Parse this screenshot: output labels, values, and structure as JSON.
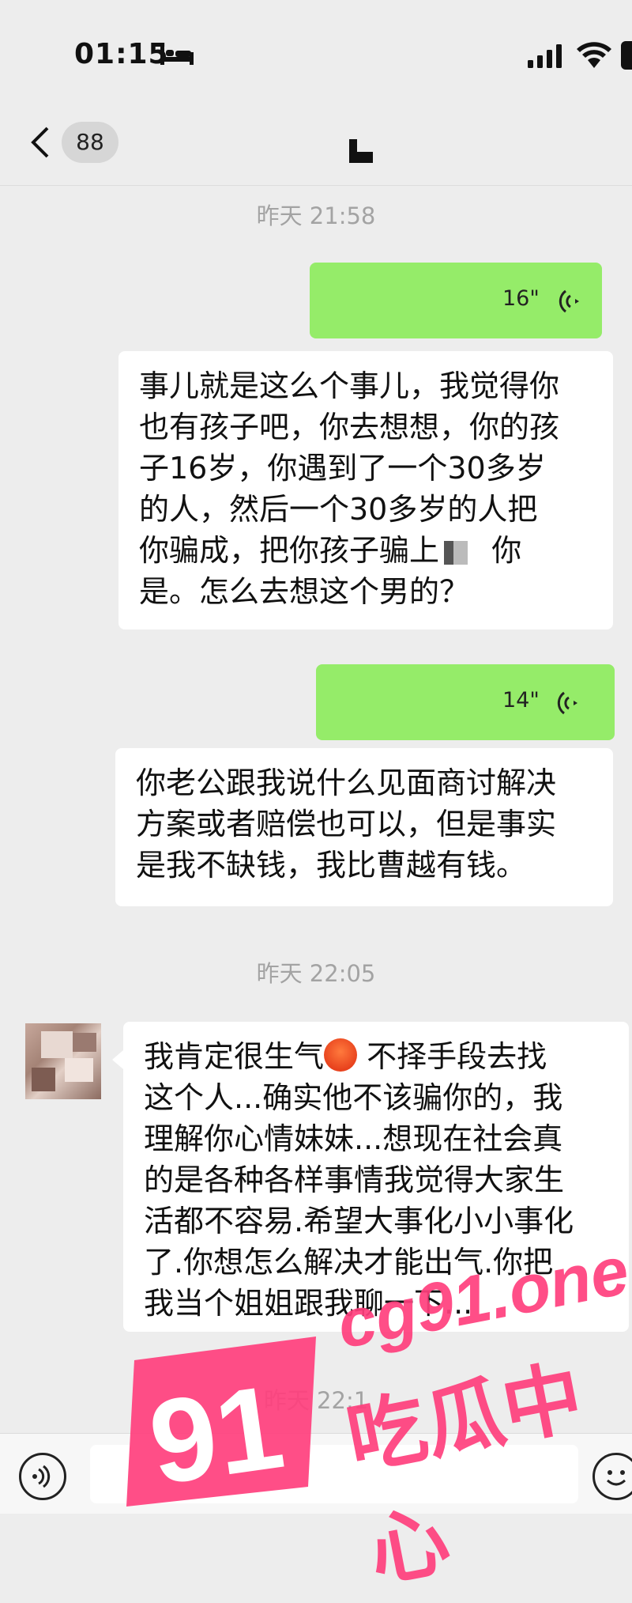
{
  "status_bar": {
    "time": "01:15"
  },
  "nav": {
    "back_count": "88",
    "contact_name": ""
  },
  "chat": {
    "timestamp_1": "昨天 21:58",
    "voice_1": {
      "duration": "16\""
    },
    "text_1_lines": [
      "事儿就是这么个事儿，我觉得你",
      "也有孩子吧，你去想想，你的孩",
      "子16岁，你遇到了一个30多岁",
      "的人，然后一个30多岁的人把",
      "你骗成，把你孩子骗上",
      "是。怎么去想这个男的？"
    ],
    "text_1_line5_tail": "你",
    "voice_2": {
      "duration": "14\""
    },
    "text_2_lines": [
      "你老公跟我说什么见面商讨解决",
      "方案或者赔偿也可以，但是事实",
      "是我不缺钱，我比曹越有钱。"
    ],
    "timestamp_2": "昨天 22:05",
    "text_3_line1_a": "我肯定很生气",
    "text_3_line1_b": " 不择手段去找",
    "text_3_lines": [
      "这个人...确实他不该骗你的，我",
      "理解你心情妹妹...想现在社会真",
      "的是各种各样事情我觉得大家生",
      "活都不容易.希望大事化小小事化",
      "了.你想怎么解决才能出气.你把",
      "我当个姐姐跟我聊一下..."
    ],
    "timestamp_3": "昨天 22:1"
  },
  "watermark": {
    "domain": "cg91.one",
    "site": "吃瓜中心",
    "logo": "91"
  },
  "colors": {
    "sent_bubble": "#95ec69",
    "received_bubble": "#ffffff",
    "background": "#ededed",
    "watermark": "#ff3f7d"
  }
}
